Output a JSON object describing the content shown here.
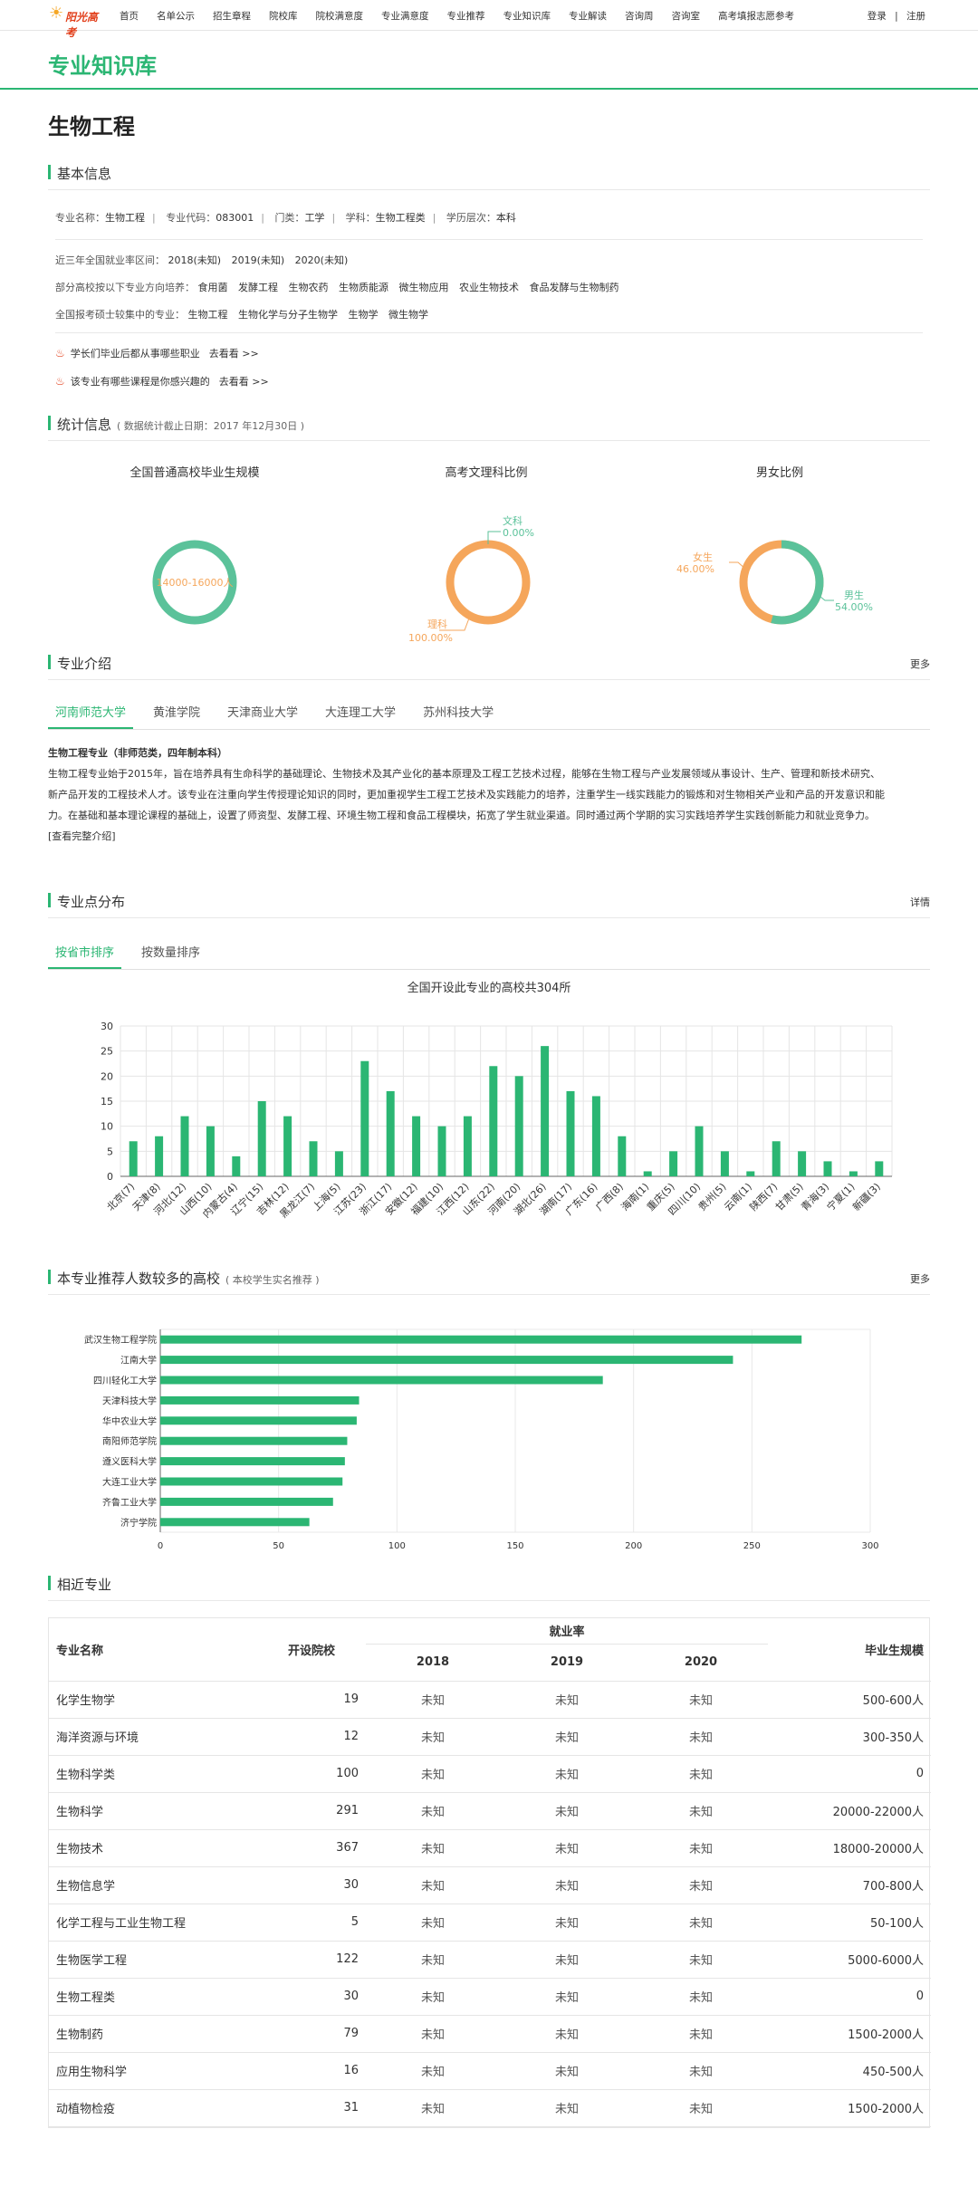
{
  "nav": {
    "logo_text": "阳光高考",
    "links": [
      "首页",
      "名单公示",
      "招生章程",
      "院校库",
      "院校满意度",
      "专业满意度",
      "专业推荐",
      "专业知识库",
      "专业解读",
      "咨询周",
      "咨询室",
      "高考填报志愿参考"
    ],
    "login": "登录",
    "separator": "|",
    "register": "注册"
  },
  "banner_title": "专业知识库",
  "page_title": "生物工程",
  "basic": {
    "heading": "基本信息",
    "name_label": "专业名称：",
    "name": "生物工程",
    "code_label": "专业代码：",
    "code": "083001",
    "category_label": "门类：",
    "category": "工学",
    "discipline_label": "学科：",
    "discipline": "生物工程类",
    "level_label": "学历层次：",
    "level": "本科",
    "employ_label": "近三年全国就业率区间：",
    "employ": [
      "2018(未知)",
      "2019(未知)",
      "2020(未知)"
    ],
    "directions_label": "部分高校按以下专业方向培养：",
    "directions": [
      "食用菌",
      "发酵工程",
      "生物农药",
      "生物质能源",
      "微生物应用",
      "农业生物技术",
      "食品发酵与生物制药"
    ],
    "master_label": "全国报考硕士较集中的专业：",
    "master": [
      "生物工程",
      "生物化学与分子生物学",
      "生物学",
      "微生物学"
    ],
    "tip1": "学长们毕业后都从事哪些职业",
    "tip2": "该专业有哪些课程是你感兴趣的",
    "go_label": "去看看 >>"
  },
  "stats": {
    "heading": "统计信息",
    "sub": "( 数据统计截止日期：2017 年12月30日 )",
    "d1_title": "全国普通高校毕业生规模",
    "d1_label": "14000-16000人",
    "d2_title": "高考文理科比例",
    "d2_wen_name": "文科",
    "d2_wen_pct": "0.00%",
    "d2_li_name": "理科",
    "d2_li_pct": "100.00%",
    "d3_title": "男女比例",
    "d3_f_name": "女生",
    "d3_f_pct": "46.00%",
    "d3_m_name": "男生",
    "d3_m_pct": "54.00%",
    "colors": {
      "green": "#5bc29a",
      "orange": "#f5a65b",
      "accent": "#2bb673"
    }
  },
  "intro": {
    "heading": "专业介绍",
    "more": "更多",
    "tabs": [
      "河南师范大学",
      "黄淮学院",
      "天津商业大学",
      "大连理工大学",
      "苏州科技大学"
    ],
    "subtitle": "生物工程专业（非师范类，四年制本科）",
    "lines": [
      "生物工程专业始于2015年，旨在培养具有生命科学的基础理论、生物技术及其产业化的基本原理及工程工艺技术过程，能够在生物工程与产业发展领域从事设计、生产、管理和新技术研究、",
      "新产品开发的工程技术人才。该专业在注重向学生传授理论知识的同时，更加重视学生工程工艺技术及实践能力的培养，注重学生一线实践能力的锻炼和对生物相关产业和产品的开发意识和能",
      "力。在基础和基本理论课程的基础上，设置了师资型、发酵工程、环境生物工程和食品工程模块，拓宽了学生就业渠道。同时通过两个学期的实习实践培养学生实践创新能力和就业竞争力。"
    ],
    "full_link": "[查看完整介绍]"
  },
  "distribution": {
    "heading": "专业点分布",
    "more": "详情",
    "tabs": [
      "按省市排序",
      "按数量排序"
    ],
    "chart_title": "全国开设此专业的高校共304所"
  },
  "recommend": {
    "heading": "本专业推荐人数较多的高校",
    "sub": "( 本校学生实名推荐 )",
    "more": "更多"
  },
  "related": {
    "heading": "相近专业",
    "h_name": "专业名称",
    "h_schools": "开设院校",
    "h_employ": "就业率",
    "h_years": [
      "2018",
      "2019",
      "2020"
    ],
    "h_scale": "毕业生规模",
    "rows": [
      {
        "name": "化学生物学",
        "schools": "19",
        "y1": "未知",
        "y2": "未知",
        "y3": "未知",
        "scale": "500-600人"
      },
      {
        "name": "海洋资源与环境",
        "schools": "12",
        "y1": "未知",
        "y2": "未知",
        "y3": "未知",
        "scale": "300-350人"
      },
      {
        "name": "生物科学类",
        "schools": "100",
        "y1": "未知",
        "y2": "未知",
        "y3": "未知",
        "scale": "0"
      },
      {
        "name": "生物科学",
        "schools": "291",
        "y1": "未知",
        "y2": "未知",
        "y3": "未知",
        "scale": "20000-22000人"
      },
      {
        "name": "生物技术",
        "schools": "367",
        "y1": "未知",
        "y2": "未知",
        "y3": "未知",
        "scale": "18000-20000人"
      },
      {
        "name": "生物信息学",
        "schools": "30",
        "y1": "未知",
        "y2": "未知",
        "y3": "未知",
        "scale": "700-800人"
      },
      {
        "name": "化学工程与工业生物工程",
        "schools": "5",
        "y1": "未知",
        "y2": "未知",
        "y3": "未知",
        "scale": "50-100人"
      },
      {
        "name": "生物医学工程",
        "schools": "122",
        "y1": "未知",
        "y2": "未知",
        "y3": "未知",
        "scale": "5000-6000人"
      },
      {
        "name": "生物工程类",
        "schools": "30",
        "y1": "未知",
        "y2": "未知",
        "y3": "未知",
        "scale": "0"
      },
      {
        "name": "生物制药",
        "schools": "79",
        "y1": "未知",
        "y2": "未知",
        "y3": "未知",
        "scale": "1500-2000人"
      },
      {
        "name": "应用生物科学",
        "schools": "16",
        "y1": "未知",
        "y2": "未知",
        "y3": "未知",
        "scale": "450-500人"
      },
      {
        "name": "动植物检疫",
        "schools": "31",
        "y1": "未知",
        "y2": "未知",
        "y3": "未知",
        "scale": "1500-2000人"
      }
    ]
  },
  "chart_data": [
    {
      "type": "bar",
      "title": "全国开设此专业的高校共304所",
      "categories": [
        "北京(7)",
        "天津(8)",
        "河北(12)",
        "山西(10)",
        "内蒙古(4)",
        "辽宁(15)",
        "吉林(12)",
        "黑龙江(7)",
        "上海(5)",
        "江苏(23)",
        "浙江(17)",
        "安徽(12)",
        "福建(10)",
        "江西(12)",
        "山东(22)",
        "河南(20)",
        "湖北(26)",
        "湖南(17)",
        "广东(16)",
        "广西(8)",
        "海南(1)",
        "重庆(5)",
        "四川(10)",
        "贵州(5)",
        "云南(1)",
        "陕西(7)",
        "甘肃(5)",
        "青海(3)",
        "宁夏(1)",
        "新疆(3)"
      ],
      "values": [
        7,
        8,
        12,
        10,
        4,
        15,
        12,
        7,
        5,
        23,
        17,
        12,
        10,
        12,
        22,
        20,
        26,
        17,
        16,
        8,
        1,
        5,
        10,
        5,
        1,
        7,
        5,
        3,
        1,
        3
      ],
      "ylim": [
        0,
        30
      ],
      "yticks": [
        0,
        5,
        10,
        15,
        20,
        25,
        30
      ],
      "color": "#2bb673"
    },
    {
      "type": "bar",
      "orientation": "horizontal",
      "categories": [
        "武汉生物工程学院",
        "江南大学",
        "四川轻化工大学",
        "天津科技大学",
        "华中农业大学",
        "南阳师范学院",
        "遵义医科大学",
        "大连工业大学",
        "齐鲁工业大学",
        "济宁学院"
      ],
      "values": [
        271,
        242,
        187,
        84,
        83,
        79,
        78,
        77,
        73,
        63
      ],
      "xlim": [
        0,
        300
      ],
      "xticks": [
        0,
        50,
        100,
        150,
        200,
        250,
        300
      ],
      "color": "#2bb673"
    }
  ]
}
